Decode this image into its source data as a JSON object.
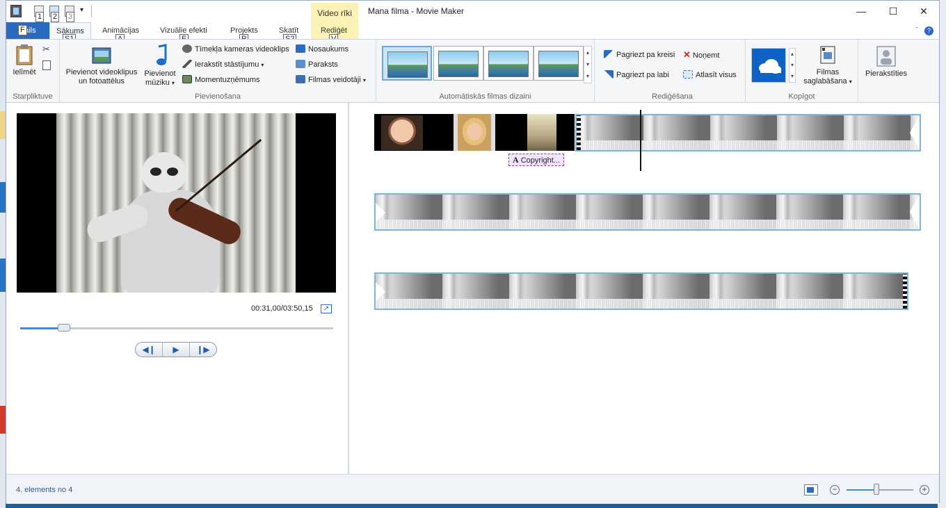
{
  "window": {
    "title": "Mana filma - Movie Maker",
    "contextual_tab": "Video rīki"
  },
  "quick_access": {
    "keytips": [
      "1",
      "2",
      "3"
    ]
  },
  "tabs": [
    {
      "label": "Fails",
      "keytip": "F"
    },
    {
      "label": "Sākums",
      "keytip": "S1"
    },
    {
      "label": "Animācijas",
      "keytip": "A"
    },
    {
      "label": "Vizuālie efekti",
      "keytip": "E"
    },
    {
      "label": "Projekts",
      "keytip": "P"
    },
    {
      "label": "Skatīt",
      "keytip": "S2"
    },
    {
      "label": "Rediģēt",
      "keytip": "V"
    }
  ],
  "ribbon": {
    "clipboard": {
      "label": "Starpliktuve",
      "paste": "Ielīmēt"
    },
    "add": {
      "label": "Pievienošana",
      "add_videos": "Pievienot videoklipus un fotoattēlus",
      "add_music": "Pievienot mūziku",
      "webcam": "Tīmekļa kameras videoklips",
      "narration": "Ierakstīt stāstījumu",
      "snapshot": "Momentuzņēmums",
      "title": "Nosaukums",
      "caption": "Paraksts",
      "credits": "Filmas veidotāji"
    },
    "themes": {
      "label": "Automātiskās filmas dizaini"
    },
    "editing": {
      "label": "Rediģēšana",
      "rotate_left": "Pagriezt pa kreisi",
      "rotate_right": "Pagriezt pa labi",
      "remove": "Noņemt",
      "select_all": "Atlasīt visus"
    },
    "share": {
      "label": "Kopīgot",
      "save_movie": "Filmas saglabāšana"
    },
    "account": {
      "sign_in": "Pierakstīties"
    }
  },
  "preview": {
    "timecode": "00:31,00/03:50,15",
    "progress": 0.14
  },
  "storyboard": {
    "caption_item": "Copyright..."
  },
  "status": {
    "items_text": "4. elements no 4",
    "zoom_level": 0.45
  }
}
